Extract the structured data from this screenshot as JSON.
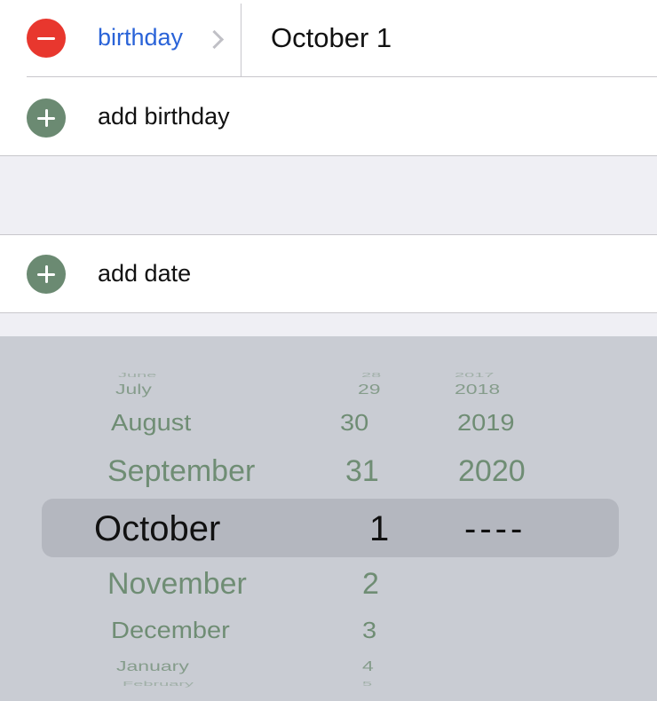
{
  "birthday_row": {
    "label": "birthday",
    "value": "October 1"
  },
  "add_birthday": {
    "label": "add birthday"
  },
  "add_date": {
    "label": "add date"
  },
  "picker": {
    "months": [
      "June",
      "July",
      "August",
      "September",
      "October",
      "November",
      "December",
      "January",
      "February"
    ],
    "days": [
      "28",
      "29",
      "30",
      "31",
      "1",
      "2",
      "3",
      "4",
      "5"
    ],
    "years": [
      "2017",
      "2018",
      "2019",
      "2020",
      "----"
    ],
    "selected": {
      "month": "October",
      "day": "1",
      "year": "----"
    }
  },
  "colors": {
    "delete_red": "#e8372e",
    "add_green": "#6b8a72",
    "link_blue": "#2a63d8",
    "picker_text": "#6f8d74"
  }
}
